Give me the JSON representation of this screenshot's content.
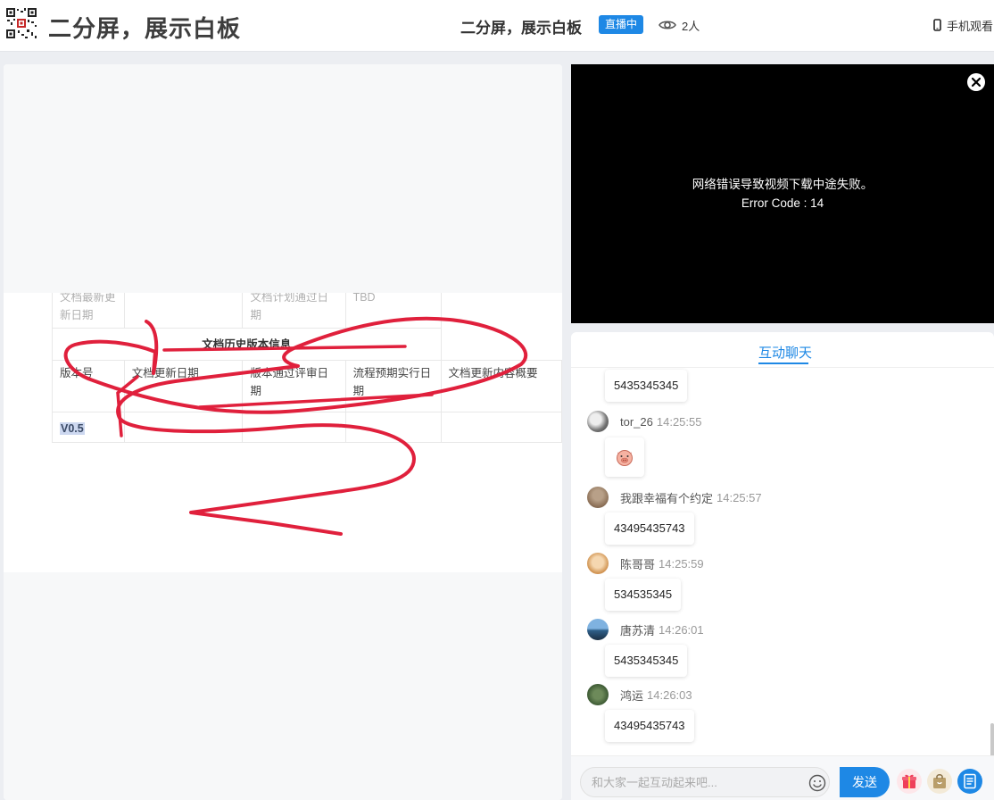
{
  "header": {
    "app_title": "二分屏，展示白板",
    "center_title": "二分屏，展示白板",
    "live_badge": "直播中",
    "viewer_count": "2人",
    "mobile_watch": "手机观看"
  },
  "document": {
    "row0": {
      "c1": "文档最新更新日期",
      "c3": "文档计划通过日期",
      "c4": "TBD"
    },
    "section_title": "文档历史版本信息",
    "headers": [
      "版本号",
      "文档更新日期",
      "版本通过评审日期",
      "流程预期实行日期",
      "文档更新内容概要"
    ],
    "version": "V0.5"
  },
  "video": {
    "error_line1": "网络错误导致视频下载中途失败。",
    "error_line2": "Error Code : 14"
  },
  "chat": {
    "tab_label": "互动聊天",
    "messages": [
      {
        "nick": "",
        "time": "",
        "text": "5435345345"
      },
      {
        "nick": "tor_26",
        "time": "14:25:55",
        "text": ""
      },
      {
        "nick": "我跟幸福有个约定",
        "time": "14:25:57",
        "text": "43495435743"
      },
      {
        "nick": "陈哥哥",
        "time": "14:25:59",
        "text": "534535345"
      },
      {
        "nick": "唐苏清",
        "time": "14:26:01",
        "text": "5435345345"
      },
      {
        "nick": "鸿运",
        "time": "14:26:03",
        "text": "43495435743"
      }
    ],
    "input_placeholder": "和大家一起互动起来吧...",
    "send_label": "发送"
  },
  "colors": {
    "accent": "#1e88e5",
    "scribble": "#e0203c"
  }
}
